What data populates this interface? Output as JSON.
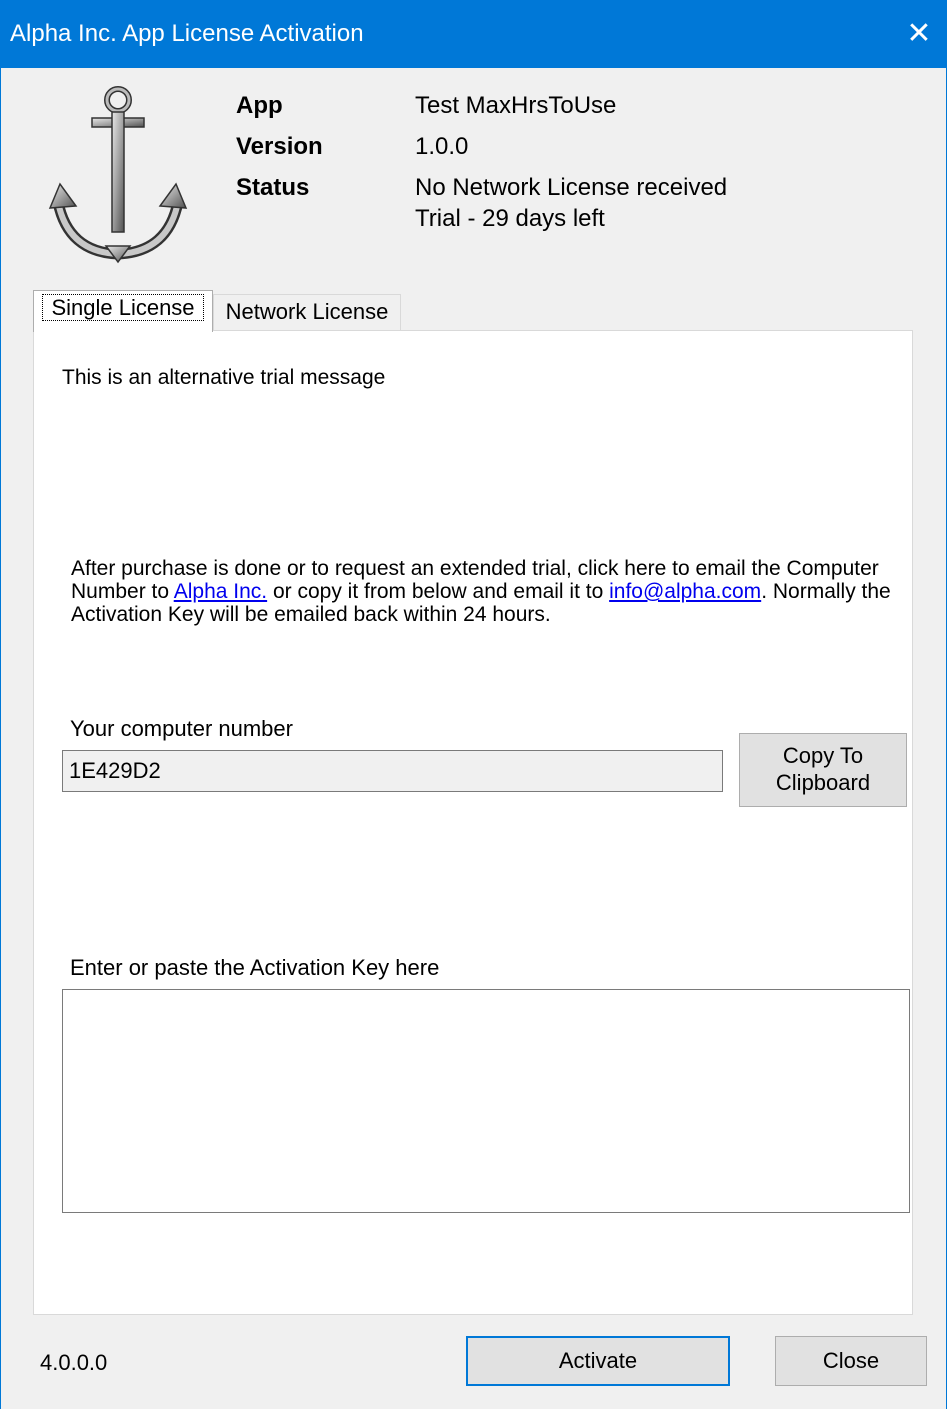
{
  "window": {
    "title": "Alpha Inc. App License Activation",
    "close_glyph": "✕"
  },
  "logo": {
    "icon": "anchor-icon"
  },
  "info": {
    "app_label": "App",
    "app_value": "Test MaxHrsToUse",
    "version_label": "Version",
    "version_value": "1.0.0",
    "status_label": "Status",
    "status_line1": "No Network License received",
    "status_line2": "Trial - 29 days left"
  },
  "tabs": [
    {
      "label": "Single License",
      "active": true
    },
    {
      "label": "Network License",
      "active": false
    }
  ],
  "single": {
    "trial_message": "This is an alternative trial message",
    "instructions": {
      "part1": "After purchase is done or to request an extended trial, click here to email the Computer Number to ",
      "link1": "Alpha Inc.",
      "part2": " or copy it from below and email it to ",
      "link2": "info@alpha.com",
      "part3": ". Normally the Activation Key will be emailed back within 24 hours."
    },
    "computer_number_label": "Your computer number",
    "computer_number_value": "1E429D2",
    "copy_button_line1": "Copy To",
    "copy_button_line2": "Clipboard",
    "activation_key_label": "Enter or paste the Activation Key here",
    "activation_key_value": ""
  },
  "footer": {
    "version": "4.0.0.0",
    "activate_label": "Activate",
    "close_label": "Close"
  },
  "colors": {
    "titlebar": "#0078d7",
    "link": "#0000ee",
    "focus_border": "#0078d7"
  }
}
